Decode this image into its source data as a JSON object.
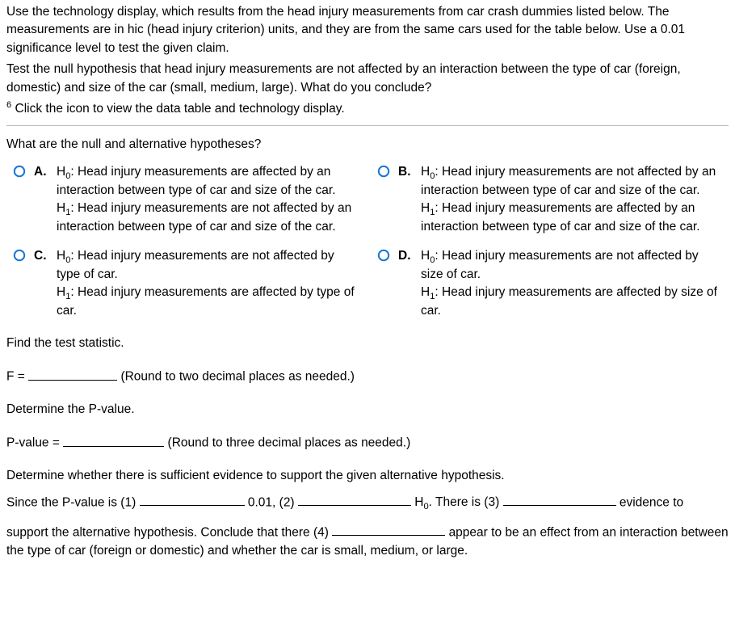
{
  "intro": {
    "p1": "Use the technology display, which results from the head injury measurements from car crash dummies listed below. The measurements are in hic (head injury criterion) units, and they are from the same cars used for the table below. Use a 0.01 significance level to test the given claim.",
    "p2": "Test the null hypothesis that head injury measurements are not affected by an interaction between the type of car (foreign, domestic) and size of the car (small, medium, large). What do you conclude?",
    "footnote_mark": "6",
    "p3": " Click the icon to view the data table and technology display."
  },
  "q_hypotheses": "What are the null and alternative hypotheses?",
  "choices": {
    "A": {
      "letter": "A.",
      "h0_label": "H",
      "h0_sub": "0",
      "h0_text": ": Head injury measurements are affected by an interaction between type of car and size of the car.",
      "h1_label": "H",
      "h1_sub": "1",
      "h1_text": ": Head injury measurements are not affected by an interaction between type of car and size of the car."
    },
    "B": {
      "letter": "B.",
      "h0_label": "H",
      "h0_sub": "0",
      "h0_text": ": Head injury measurements are not affected by an interaction between type of car and size of the car.",
      "h1_label": "H",
      "h1_sub": "1",
      "h1_text": ": Head injury measurements are affected by an interaction between type of car and size of the car."
    },
    "C": {
      "letter": "C.",
      "h0_label": "H",
      "h0_sub": "0",
      "h0_text": ": Head injury measurements are not affected by type of car.",
      "h1_label": "H",
      "h1_sub": "1",
      "h1_text": ": Head injury measurements are affected by type of car."
    },
    "D": {
      "letter": "D.",
      "h0_label": "H",
      "h0_sub": "0",
      "h0_text": ": Head injury measurements are not affected by size of car.",
      "h1_label": "H",
      "h1_sub": "1",
      "h1_text": ": Head injury measurements are affected by size of car."
    }
  },
  "find_stat": {
    "title": "Find the test statistic.",
    "f_label": "F =",
    "hint": "(Round to two decimal places as needed.)"
  },
  "pvalue": {
    "title": "Determine the P-value.",
    "label": "P-value =",
    "hint": "(Round to three decimal places as needed.)"
  },
  "concl": {
    "title": "Determine whether there is sufficient evidence to support the given alternative hypothesis.",
    "s1a": "Since the P-value is  (1)",
    "s1b": " 0.01,  (2)",
    "s1c_pre": " H",
    "s1c_sub": "0",
    "s1c_post": ". There is  (3)",
    "s1d": " evidence to",
    "s2a": "support the alternative hypothesis. Conclude that there  (4)",
    "s2b": " appear to be an effect from an interaction between the type of car (foreign or domestic) and whether the car is small, medium, or large."
  }
}
